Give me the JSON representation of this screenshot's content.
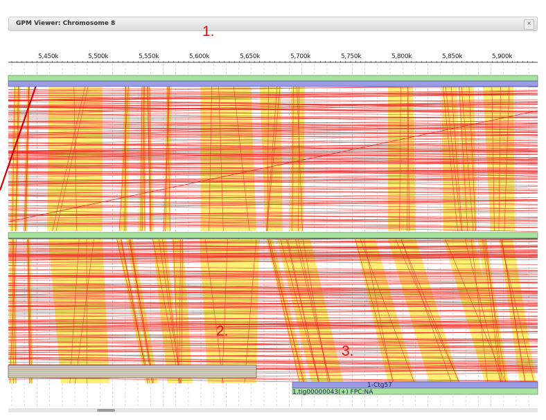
{
  "window": {
    "title": "GPM Viewer: Chromosome 8",
    "close_glyph": "×"
  },
  "annotations": [
    "1.",
    "2.",
    "3."
  ],
  "ruler": {
    "ticks": [
      "5,450k",
      "5,500k",
      "5,550k",
      "5,600k",
      "5,650k",
      "5,700k",
      "5,750k",
      "5,800k",
      "5,850k",
      "5,900k"
    ]
  },
  "tracks": {
    "contig_label": "1-Ctg57",
    "sequence_label": "1.tig00000043(+) FPC:NA"
  },
  "colors": {
    "match_band": "#ffef5a",
    "link_line": "#ee2222",
    "track_green": "#a8e4a0",
    "track_blue": "#9b9be6",
    "annotation": "#e01010"
  }
}
